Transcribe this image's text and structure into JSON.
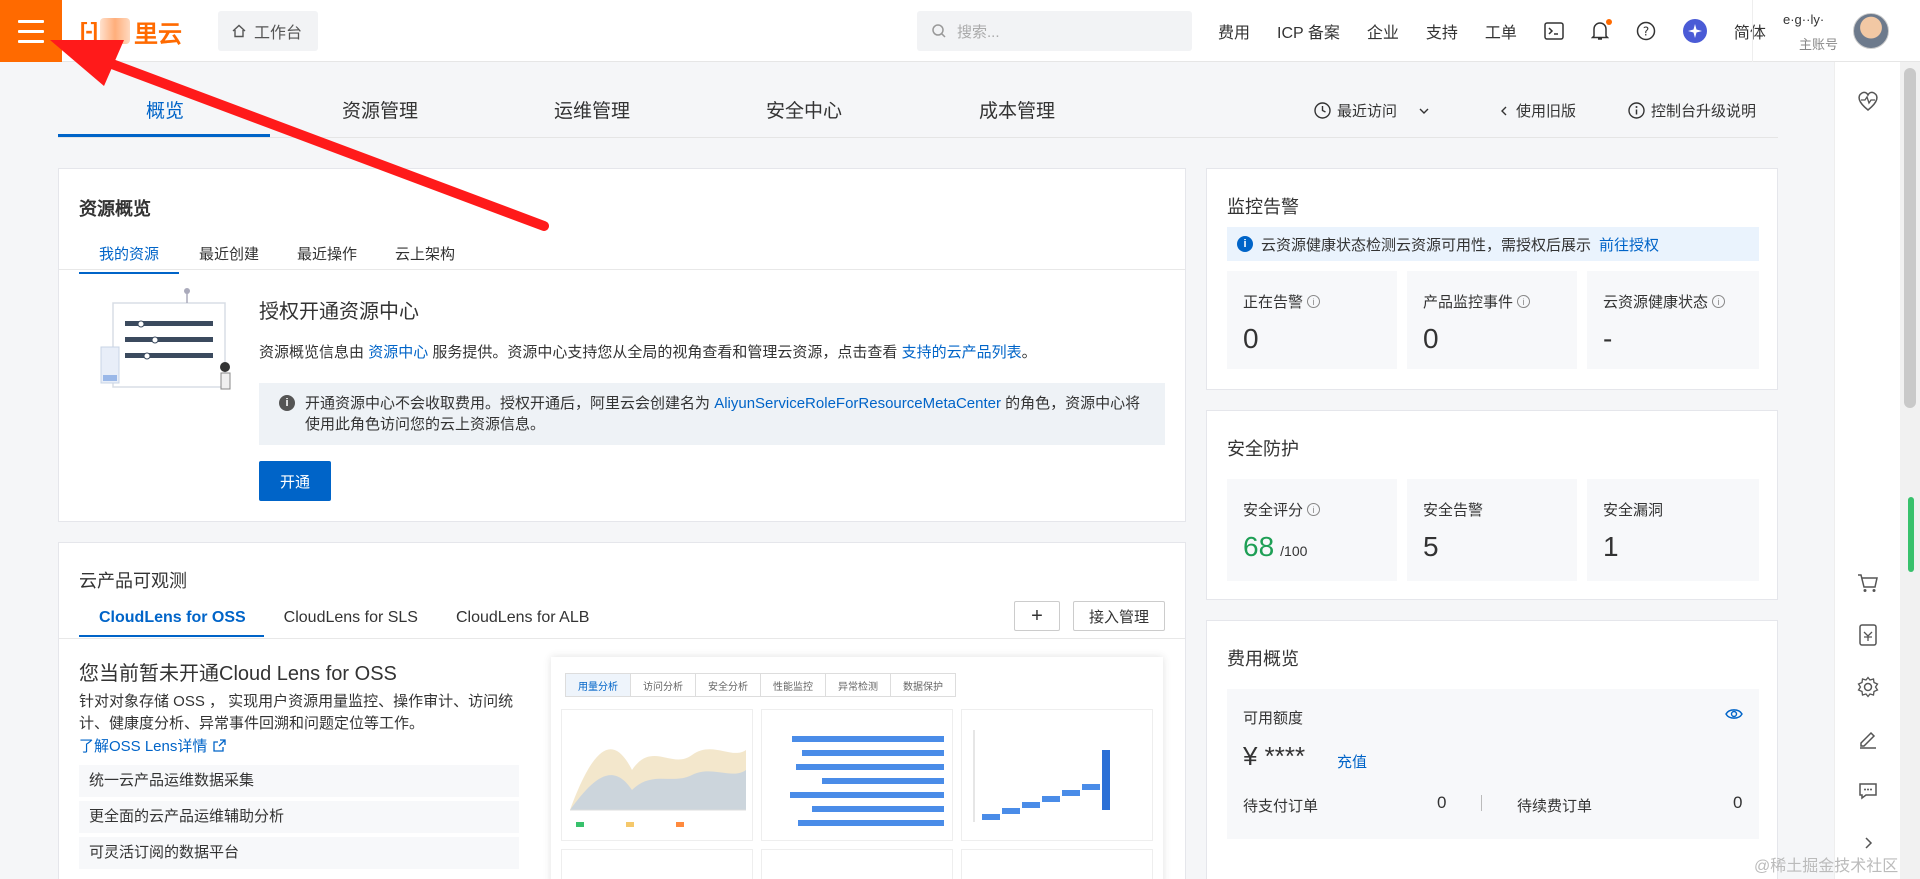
{
  "topbar": {
    "logo_text": "里云",
    "workbench_label": "工作台",
    "search_placeholder": "搜索...",
    "nav": [
      "费用",
      "ICP 备案",
      "企业",
      "支持",
      "工单"
    ],
    "language": "简体",
    "user_name": "e·g··ly·",
    "user_sub": "主账号"
  },
  "main_tabs": {
    "items": [
      "概览",
      "资源管理",
      "运维管理",
      "安全中心",
      "成本管理"
    ],
    "active": "概览",
    "recent": "最近访问",
    "old_version": "使用旧版",
    "upgrade_note": "控制台升级说明"
  },
  "resource_overview": {
    "title": "资源概览",
    "tabs": [
      "我的资源",
      "最近创建",
      "最近操作",
      "云上架构"
    ],
    "heading": "授权开通资源中心",
    "desc_prefix": "资源概览信息由",
    "desc_link1": "资源中心",
    "desc_mid": "服务提供。资源中心支持您从全局的视角查看和管理云资源，点击查看",
    "desc_link2": "支持的云产品列表",
    "desc_end": "。",
    "notice_prefix": "开通资源中心不会收取费用。授权开通后，阿里云会创建名为",
    "notice_link": "AliyunServiceRoleForResourceMetaCenter",
    "notice_suffix": "的角色，资源中心将使用此角色访问您的云上资源信息。",
    "button": "开通"
  },
  "observability": {
    "title": "云产品可观测",
    "tabs": [
      "CloudLens for OSS",
      "CloudLens for SLS",
      "CloudLens for ALB"
    ],
    "add_btn": "+",
    "manage_btn": "接入管理",
    "heading": "您当前暂未开通Cloud Lens for OSS",
    "desc": "针对对象存储 OSS ， 实现用户资源用量监控、操作审计、访问统计、健康度分析、异常事件回溯和问题定位等工作。",
    "learn_more": "了解OSS Lens详情",
    "features": [
      "统一云产品运维数据采集",
      "更全面的云产品运维辅助分析",
      "可灵活订阅的数据平台"
    ],
    "preview_tabs": [
      "用量分析",
      "访问分析",
      "安全分析",
      "性能监控",
      "异常检测",
      "数据保护"
    ]
  },
  "monitoring": {
    "title": "监控告警",
    "notice": "云资源健康状态检测云资源可用性，需授权后展示",
    "notice_link": "前往授权",
    "stats": [
      {
        "label": "正在告警",
        "value": "0"
      },
      {
        "label": "产品监控事件",
        "value": "0"
      },
      {
        "label": "云资源健康状态",
        "value": "-"
      }
    ]
  },
  "security": {
    "title": "安全防护",
    "score_label": "安全评分",
    "score": "68",
    "score_total": "/100",
    "alerts_label": "安全告警",
    "alerts": "5",
    "vulns_label": "安全漏洞",
    "vulns": "1"
  },
  "costs": {
    "title": "费用概览",
    "available_label": "可用额度",
    "amount": "¥ ****",
    "recharge": "充值",
    "pending_pay_label": "待支付订单",
    "pending_pay": "0",
    "pending_renew_label": "待续费订单",
    "pending_renew": "0"
  },
  "watermark": "@稀土掘金技术社区",
  "colors": {
    "accent": "#0064c8",
    "brand": "#ff6a00",
    "score": "#1e9f55",
    "arrow": "#ff1a1a"
  }
}
